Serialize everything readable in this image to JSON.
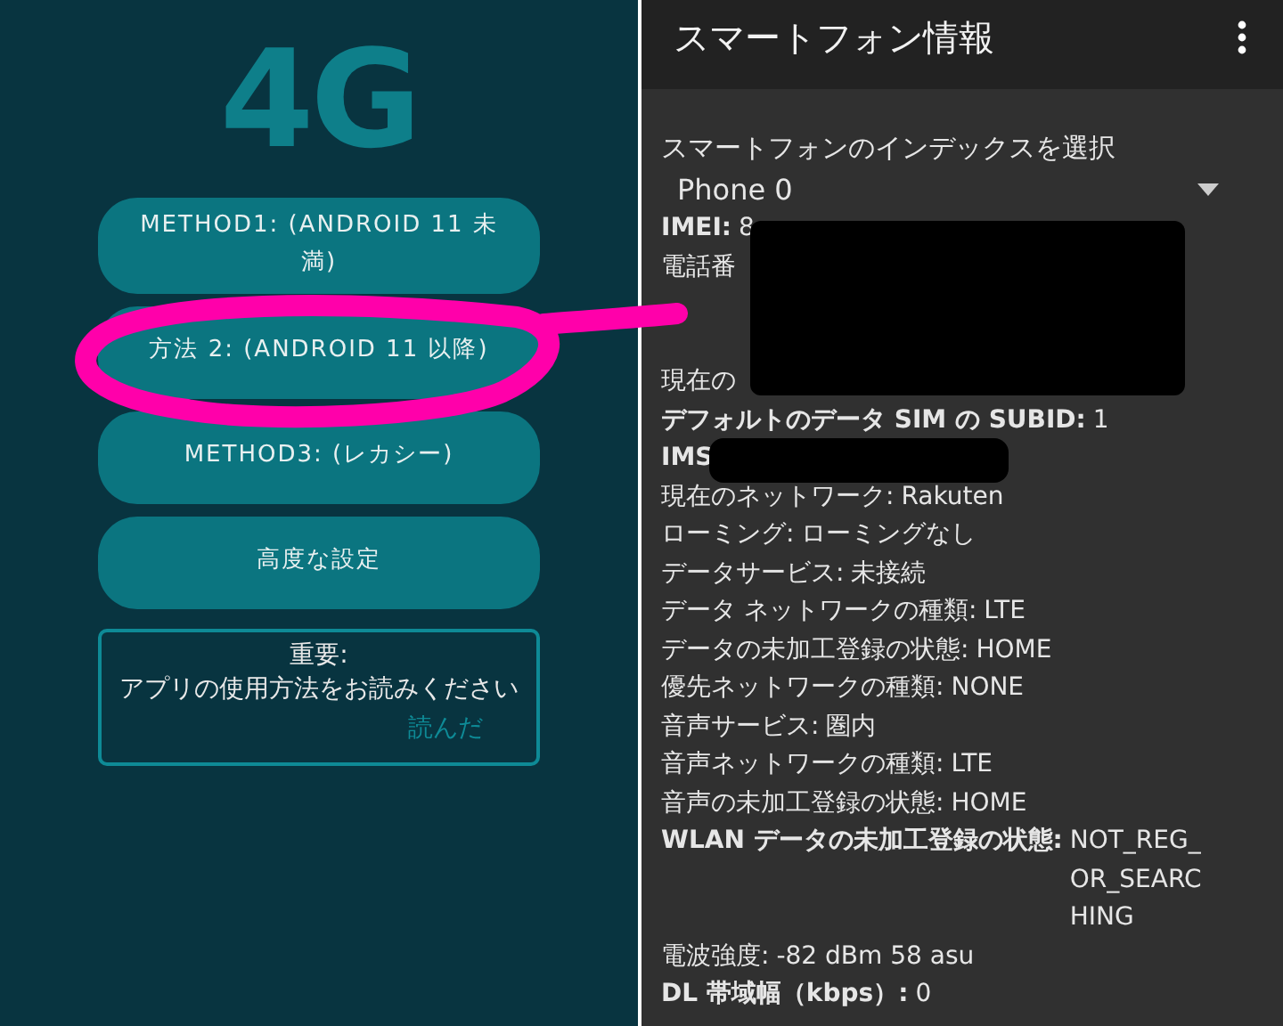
{
  "left": {
    "logo": "4G",
    "buttons": [
      "METHOD1: (ANDROID 11 未満)",
      "方法 2: (ANDROID 11 以降)",
      "METHOD3: (レカシー)",
      "高度な設定"
    ],
    "notice": {
      "title": "重要:",
      "message": "アプリの使用方法をお読みください",
      "action": "読んだ"
    }
  },
  "right": {
    "title": "スマートフォン情報",
    "select_label": "スマートフォンのインデックスを選択",
    "select_value": "Phone 0",
    "rows": [
      {
        "kind": "row",
        "label": "IMEI:",
        "value": "8",
        "bold": true
      },
      {
        "kind": "row",
        "label": "電話番",
        "bold": false
      },
      {
        "kind": "blank"
      },
      {
        "kind": "blank"
      },
      {
        "kind": "row",
        "label": "現在の",
        "bold": false
      },
      {
        "kind": "row",
        "label": "デフォルトのデータ SIM の SUBID:",
        "value": "1",
        "bold": true
      },
      {
        "kind": "masked",
        "label": "IMS",
        "bold": true
      },
      {
        "kind": "row",
        "label": "現在のネットワーク:",
        "value": "Rakuten",
        "bold": false
      },
      {
        "kind": "row",
        "label": "ローミング:",
        "value": "ローミングなし",
        "bold": false
      },
      {
        "kind": "row",
        "label": "データサービス:",
        "value": "未接続",
        "bold": false
      },
      {
        "kind": "row",
        "label": "データ ネットワークの種類:",
        "value": "LTE",
        "bold": false
      },
      {
        "kind": "row",
        "label": "データの未加工登録の状態:",
        "value": "HOME",
        "bold": false
      },
      {
        "kind": "row",
        "label": "優先ネットワークの種類:",
        "value": "NONE",
        "bold": false
      },
      {
        "kind": "row",
        "label": "音声サービス:",
        "value": "圏内",
        "bold": false
      },
      {
        "kind": "row",
        "label": "音声ネットワークの種類:",
        "value": "LTE",
        "bold": false
      },
      {
        "kind": "row",
        "label": "音声の未加工登録の状態:",
        "value": "HOME",
        "bold": false
      },
      {
        "kind": "wrap",
        "label": "WLAN データの未加工登録の状態:",
        "value": "NOT_REG_OR_SEARCHING",
        "bold": true
      },
      {
        "kind": "row",
        "label": "電波強度:",
        "value": "-82 dBm   58 asu",
        "bold": false
      },
      {
        "kind": "row",
        "label": "DL 帯域幅（kbps）:",
        "value": "0",
        "bold": true
      }
    ]
  }
}
